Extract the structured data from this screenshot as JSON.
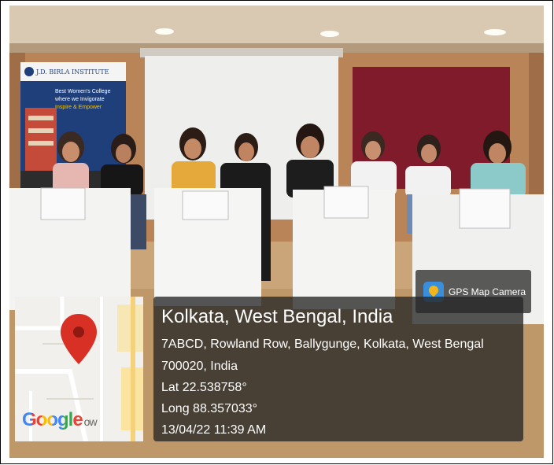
{
  "banner": {
    "institute": "J.D. BIRLA INSTITUTE",
    "line1": "Best Women's College",
    "line2": "where we Invigorate",
    "line3": "Inspire & Empower"
  },
  "placards": [
    "",
    "",
    "",
    ""
  ],
  "gps_badge": {
    "label": "GPS Map Camera",
    "icon": "gps-map-camera-icon"
  },
  "map": {
    "logo_text": "Google",
    "logo_suffix": "ow",
    "pin_color": "#d93025"
  },
  "location": {
    "title": "Kolkata, West Bengal, India",
    "address_line1": "7ABCD, Rowland Row, Ballygunge, Kolkata, West Bengal",
    "address_line2": "700020, India",
    "lat": "Lat 22.538758°",
    "long": "Long 88.357033°",
    "timestamp": "13/04/22 11:39 AM"
  }
}
